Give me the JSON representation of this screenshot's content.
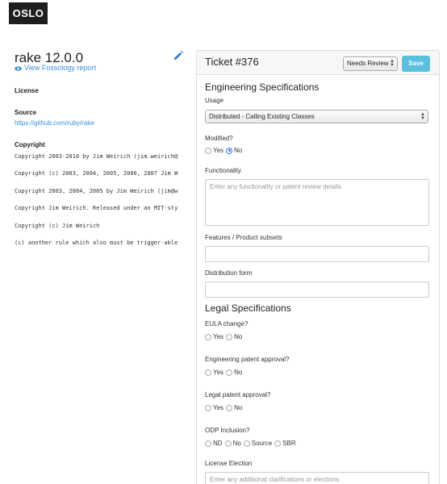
{
  "app": {
    "logo": "OSLO"
  },
  "package": {
    "title": "rake 12.0.0",
    "fossology_link": "View Fossology report",
    "license_label": "License",
    "source_label": "Source",
    "source_url": "https://github.com/ruby/rake",
    "copyright_label": "Copyright",
    "copyright_lines": [
      "Copyright 2003-2010 by Jim Weirich (jim.weirich@",
      "Copyright (c) 2003, 2004, 2005, 2006, 2007 Jim W",
      "Copyright 2003, 2004, 2005 by Jim Weirich (jim@w",
      "Copyright Jim Weirich. Released under an MIT-sty",
      "Copyright (c) Jim Weirich",
      "(c) another rule which also must be trigger-able"
    ]
  },
  "ticket": {
    "title": "Ticket #376",
    "status": "Needs Review",
    "save_label": "Save"
  },
  "engineering": {
    "title": "Engineering Specifications",
    "usage_label": "Usage",
    "usage_value": "Distributed - Calling Existing Classes",
    "modified_label": "Modified?",
    "modified_options": [
      "Yes",
      "No"
    ],
    "modified_selected": "No",
    "functionality_label": "Functionality",
    "functionality_placeholder": "Enter any functionality or patent review details",
    "features_label": "Features / Product subsets",
    "distribution_label": "Distribution form"
  },
  "legal": {
    "title": "Legal Specifications",
    "eula_label": "EULA change?",
    "eula_options": [
      "Yes",
      "No"
    ],
    "eng_patent_label": "Engineering patent approval?",
    "eng_patent_options": [
      "Yes",
      "No"
    ],
    "legal_patent_label": "Legal patent approval?",
    "legal_patent_options": [
      "Yes",
      "No"
    ],
    "odp_label": "ODP Inclusion?",
    "odp_options": [
      "ND",
      "No",
      "Source",
      "SBR"
    ],
    "license_election_label": "License Election",
    "license_election_placeholder": "Enter any additional clarifications or elections"
  },
  "colors": {
    "accent": "#3a8fd8",
    "save_button": "#5bc0de",
    "logo_bg": "#1e1e1e"
  }
}
